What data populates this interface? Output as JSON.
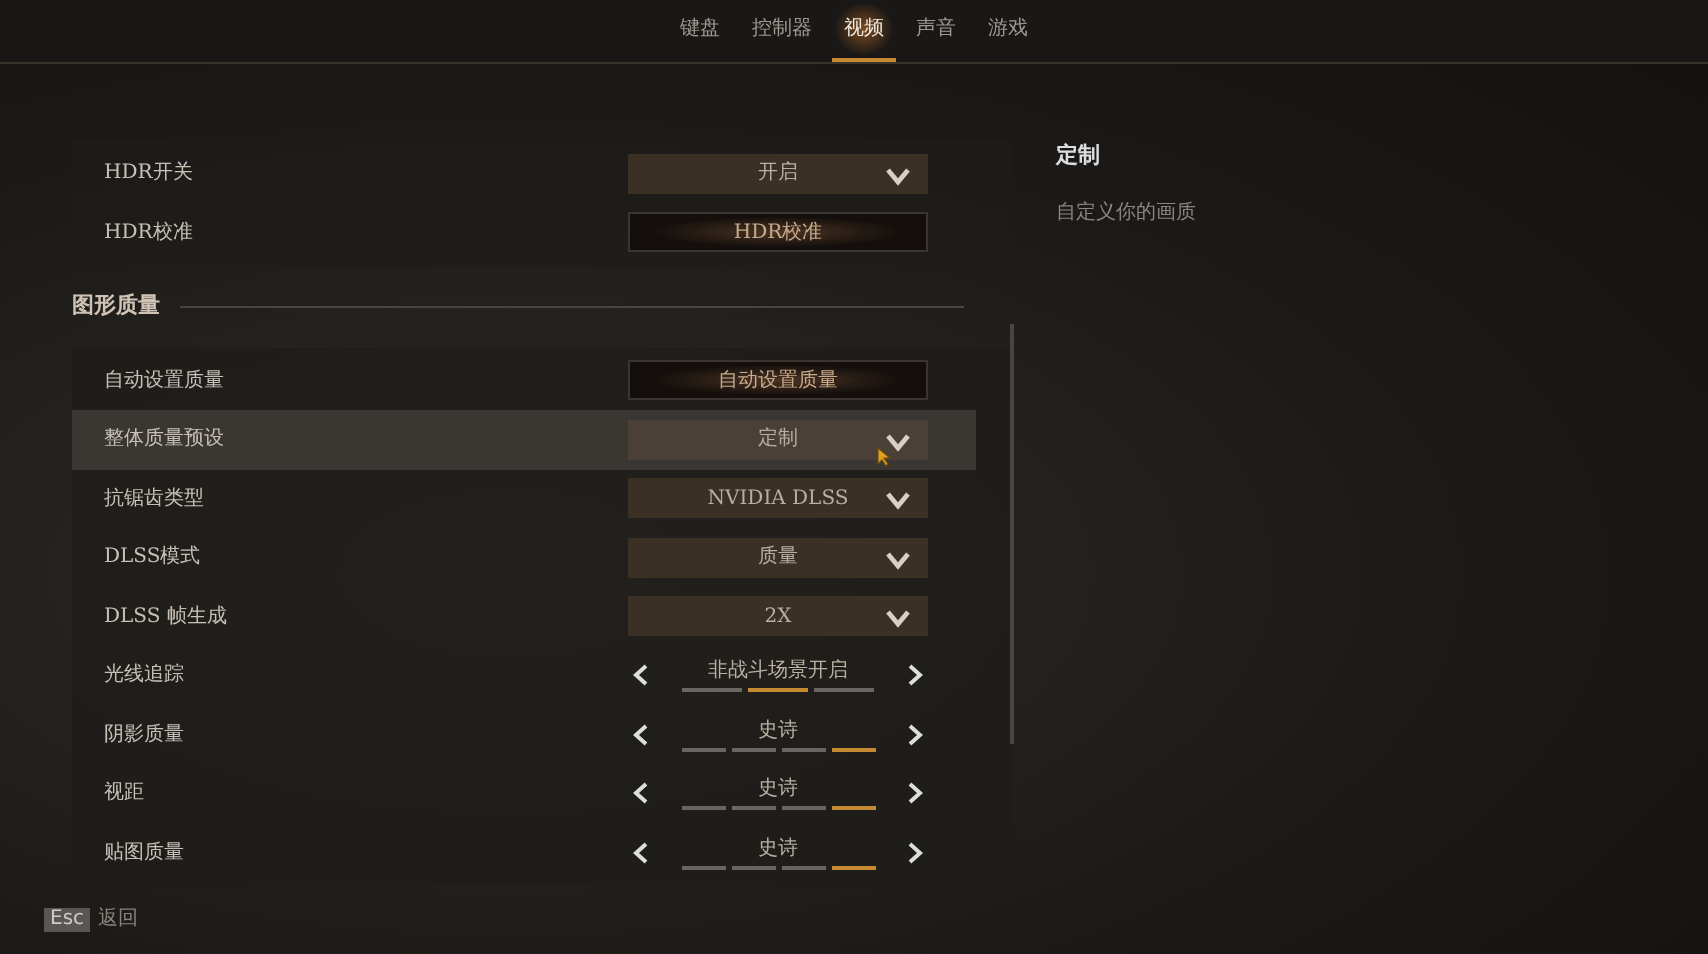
{
  "tabs": [
    {
      "label": "键盘",
      "selected": false
    },
    {
      "label": "控制器",
      "selected": false
    },
    {
      "label": "视频",
      "selected": true
    },
    {
      "label": "声音",
      "selected": false
    },
    {
      "label": "游戏",
      "selected": false
    }
  ],
  "groups": [
    {
      "rows": [
        {
          "kind": "dropdown",
          "label": "HDR开关",
          "value": "开启",
          "selected": false
        },
        {
          "kind": "button",
          "label": "HDR校准",
          "value": "HDR校准",
          "selected": false
        }
      ]
    },
    {
      "title": "图形质量",
      "rows": [
        {
          "kind": "button",
          "label": "自动设置质量",
          "value": "自动设置质量",
          "selected": false
        },
        {
          "kind": "dropdown",
          "label": "整体质量预设",
          "value": "定制",
          "selected": true
        },
        {
          "kind": "dropdown",
          "label": "抗锯齿类型",
          "value": "NVIDIA DLSS",
          "selected": false
        },
        {
          "kind": "dropdown",
          "label": "DLSS模式",
          "value": "质量",
          "selected": false
        },
        {
          "kind": "dropdown",
          "label": "DLSS 帧生成",
          "value": "2X",
          "selected": false
        },
        {
          "kind": "stepper",
          "label": "光线追踪",
          "value": "非战斗场景开启",
          "segments": [
            {
              "selected": false
            },
            {
              "selected": true
            },
            {
              "selected": false
            }
          ],
          "selected": false
        },
        {
          "kind": "stepper",
          "label": "阴影质量",
          "value": "史诗",
          "segments": [
            {
              "selected": false
            },
            {
              "selected": false
            },
            {
              "selected": false
            },
            {
              "selected": true
            }
          ],
          "selected": false
        },
        {
          "kind": "stepper",
          "label": "视距",
          "value": "史诗",
          "segments": [
            {
              "selected": false
            },
            {
              "selected": false
            },
            {
              "selected": false
            },
            {
              "selected": true
            }
          ],
          "selected": false
        },
        {
          "kind": "stepper",
          "label": "贴图质量",
          "value": "史诗",
          "segments": [
            {
              "selected": false
            },
            {
              "selected": false
            },
            {
              "selected": false
            },
            {
              "selected": true
            }
          ],
          "selected": false
        }
      ]
    }
  ],
  "detail": {
    "title": "定制",
    "description": "自定义你的画质"
  },
  "footer": {
    "key": "Esc",
    "label": "返回"
  }
}
